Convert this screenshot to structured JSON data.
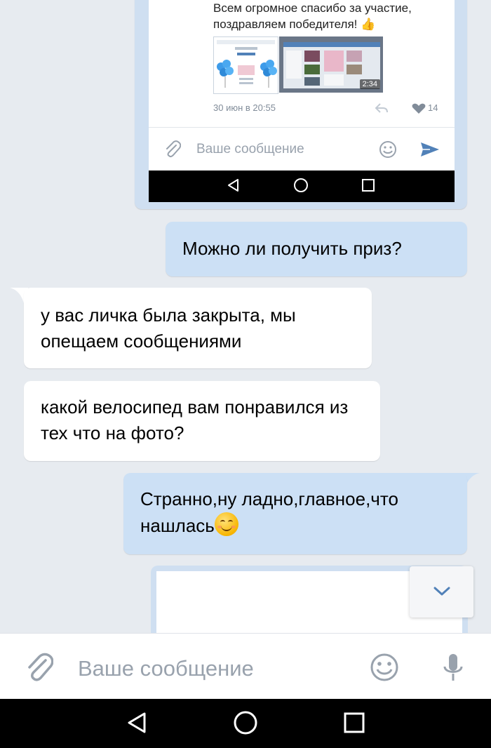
{
  "shared_post": {
    "text": "Всем огромное спасибо за участие, поздравляем победителя! 👍",
    "video_duration": "2:34",
    "date": "30 июн в 20:55",
    "likes": "14",
    "input_placeholder": "Ваше сообщение"
  },
  "messages": [
    {
      "direction": "out",
      "text": "Можно ли получить приз?"
    },
    {
      "direction": "in",
      "text": "у вас личка была закрыта, мы опещаем сообщениями"
    },
    {
      "direction": "in",
      "text": "какой велосипед вам понравился из тех что на фото?"
    },
    {
      "direction": "out",
      "text": "Странно,ну ладно,главное,что нашлась",
      "emoji": "smiling-face-icon"
    }
  ],
  "composer": {
    "placeholder": "Ваше сообщение",
    "icons": [
      "paperclip-icon",
      "smile-icon",
      "microphone-icon"
    ]
  },
  "colors": {
    "background": "#e7ebf0",
    "outgoing_bubble": "#cce0f5",
    "incoming_bubble": "#ffffff",
    "accent": "#5181b8"
  }
}
